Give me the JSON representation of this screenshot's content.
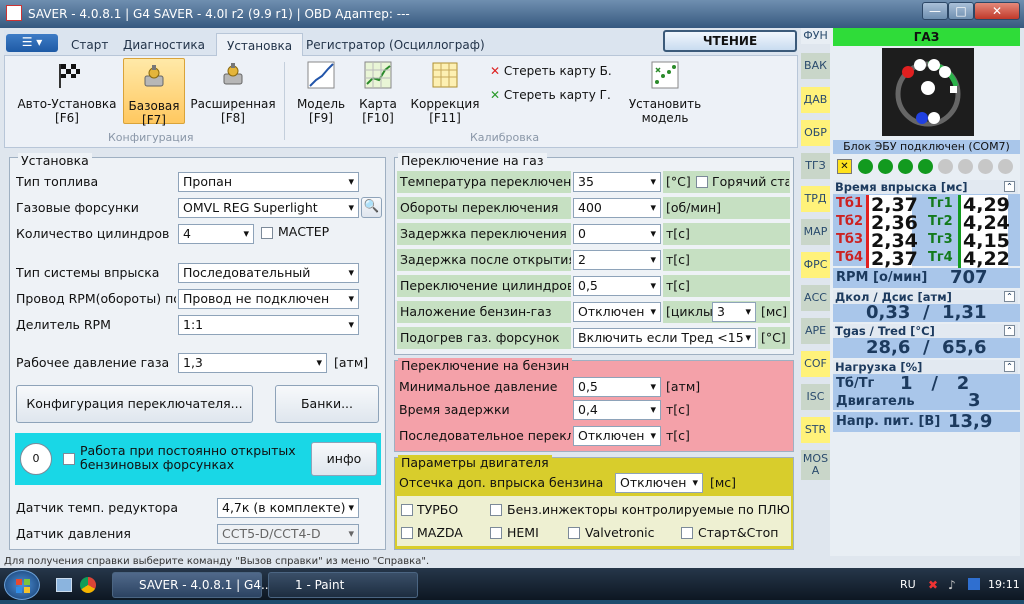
{
  "window": {
    "title": "SAVER - 4.0.8.1  |  G4 SAVER - 4.0I r2 (9.9 r1)  |  OBD Адаптер: ---",
    "min": "—",
    "max": "□",
    "close": "✕"
  },
  "tabs": [
    "Старт",
    "Диагностика",
    "Установка",
    "Регистратор (Осциллограф)"
  ],
  "active_tab": "Установка",
  "read_button": "ЧТЕНИЕ",
  "ribbon": {
    "auto_setup": "Авто-Установка\n[F6]",
    "base": "Базовая\n[F7]",
    "advanced": "Расширенная\n[F8]",
    "model": "Модель\n[F9]",
    "map": "Карта\n[F10]",
    "correction": "Коррекция\n[F11]",
    "erase_b": "Стереть карту Б.",
    "erase_g": "Стереть карту Г.",
    "set_model": "Установить\nмодель",
    "group_config": "Конфигурация",
    "group_calib": "Калибровка"
  },
  "setup": {
    "header": "Установка",
    "fuel_type_lbl": "Тип топлива",
    "fuel_type": "Пропан",
    "injectors_lbl": "Газовые форсунки",
    "injectors": "OMVL REG Superlight",
    "cylinders_lbl": "Количество цилиндров",
    "cylinders": "4",
    "master": "МАСТЕР",
    "inj_system_lbl": "Тип системы впрыска",
    "inj_system": "Последовательный",
    "rpm_wire_lbl": "Провод RPM(обороты) по",
    "rpm_wire": "Провод не подключен",
    "rpm_div_lbl": "Делитель RPM",
    "rpm_div": "1:1",
    "pressure_lbl": "Рабочее давление газа",
    "pressure": "1,3",
    "pressure_unit": "[атм]",
    "switch_cfg_btn": "Конфигурация переключателя...",
    "banks_btn": "Банки...",
    "circle": "0",
    "open_inj": "Работа при постоянно открытых\nбензиновых форсунках",
    "info_btn": "инфо",
    "temp_sensor_lbl": "Датчик темп. редуктора",
    "temp_sensor": "4,7к (в комплекте)",
    "press_sensor_lbl": "Датчик давления",
    "press_sensor": "CCT5-D/CCT4-D"
  },
  "gas_switch": {
    "header": "Переключение на газ",
    "temp_lbl": "Температура переключения",
    "temp": "35",
    "temp_unit": "[°C]",
    "hot_start": "Горячий старт",
    "rpm_lbl": "Обороты переключения",
    "rpm": "400",
    "rpm_unit": "[об/мин]",
    "delay_lbl": "Задержка переключения",
    "delay": "0",
    "delay_unit": "т[с]",
    "delay_open_lbl": "Задержка после открытия",
    "delay_open": "2",
    "delay_open_unit": "т[с]",
    "cyl_switch_lbl": "Переключение цилиндров",
    "cyl_switch": "0,5",
    "cyl_switch_unit": "т[с]",
    "overlap_lbl": "Наложение бензин-газ",
    "overlap": "Отключен",
    "cycles_lbl": "[циклы]",
    "cycles": "3",
    "cycles_unit": "[мс]",
    "heat_lbl": "Подогрев газ. форсунок",
    "heat": "Включить если Тред <15",
    "heat_unit": "[°C]"
  },
  "petrol_switch": {
    "header": "Переключение на бензин",
    "min_press_lbl": "Минимальное давление",
    "min_press": "0,5",
    "min_press_unit": "[атм]",
    "delay_lbl": "Время задержки",
    "delay": "0,4",
    "delay_unit": "т[с]",
    "seq_lbl": "Последовательное перекл.",
    "seq": "Отключен",
    "seq_unit": "т[с]"
  },
  "engine": {
    "header": "Параметры двигателя",
    "cutoff_lbl": "Отсечка доп. впрыска бензина",
    "cutoff": "Отключен",
    "cutoff_unit": "[мс]",
    "turbo": "ТУРБО",
    "petrol_inj": "Бенз.инжекторы контролируемые по ПЛЮСУ",
    "mazda": "MAZDA",
    "hemi": "HEMI",
    "valvetronic": "Valvetronic",
    "startstop": "Старт&Стоп"
  },
  "side_tabs": [
    "ФУН",
    "ВАК",
    "ДАВ",
    "ОБР",
    "ТГЗ",
    "ТРД",
    "МАР",
    "ФРС",
    "АСС",
    "АРЕ",
    "СОF",
    "ISC",
    "STR",
    "MOS A"
  ],
  "right": {
    "gas_label": "ГАЗ",
    "ecu": "Блок ЭБУ подключен (COM7)",
    "inj_time_hdr": "Время впрыска [мс]",
    "tb": [
      {
        "l": "Тб1",
        "v": "2,37"
      },
      {
        "l": "Тб2",
        "v": "2,36"
      },
      {
        "l": "Тб3",
        "v": "2,34"
      },
      {
        "l": "Тб4",
        "v": "2,37"
      }
    ],
    "tg": [
      {
        "l": "Тг1",
        "v": "4,29"
      },
      {
        "l": "Тг2",
        "v": "4,24"
      },
      {
        "l": "Тг3",
        "v": "4,15"
      },
      {
        "l": "Тг4",
        "v": "4,22"
      }
    ],
    "rpm_lbl": "RPM [о/мин]",
    "rpm": "707",
    "press_hdr": "Дкол / Дсис [атм]",
    "press": "0,33  /  1,31",
    "temp_hdr": "Tgas / Tred [°C]",
    "temp": "28,6  /  65,6",
    "load_hdr": "Нагрузка [%]",
    "load_lbl": "Тб/Тг",
    "load": "1   /   2",
    "engine_lbl": "Двигатель",
    "engine_val": "3",
    "volt_lbl": "Напр. пит. [В]",
    "volt": "13,9"
  },
  "status": "Для получения справки выберите команду \"Вызов справки\" из меню \"Справка\".",
  "taskbar": {
    "task1": "SAVER - 4.0.8.1  |  G4...",
    "task2": "1 - Paint",
    "lang": "RU",
    "clock": "19:11"
  },
  "colors": {
    "gas_green": "#c6e0c2",
    "petrol_red": "#f4a1a9",
    "engine_yellow": "#d8cd2c",
    "ribbon_selected": "#ffc860",
    "cyan_panel": "#19d7e6"
  }
}
